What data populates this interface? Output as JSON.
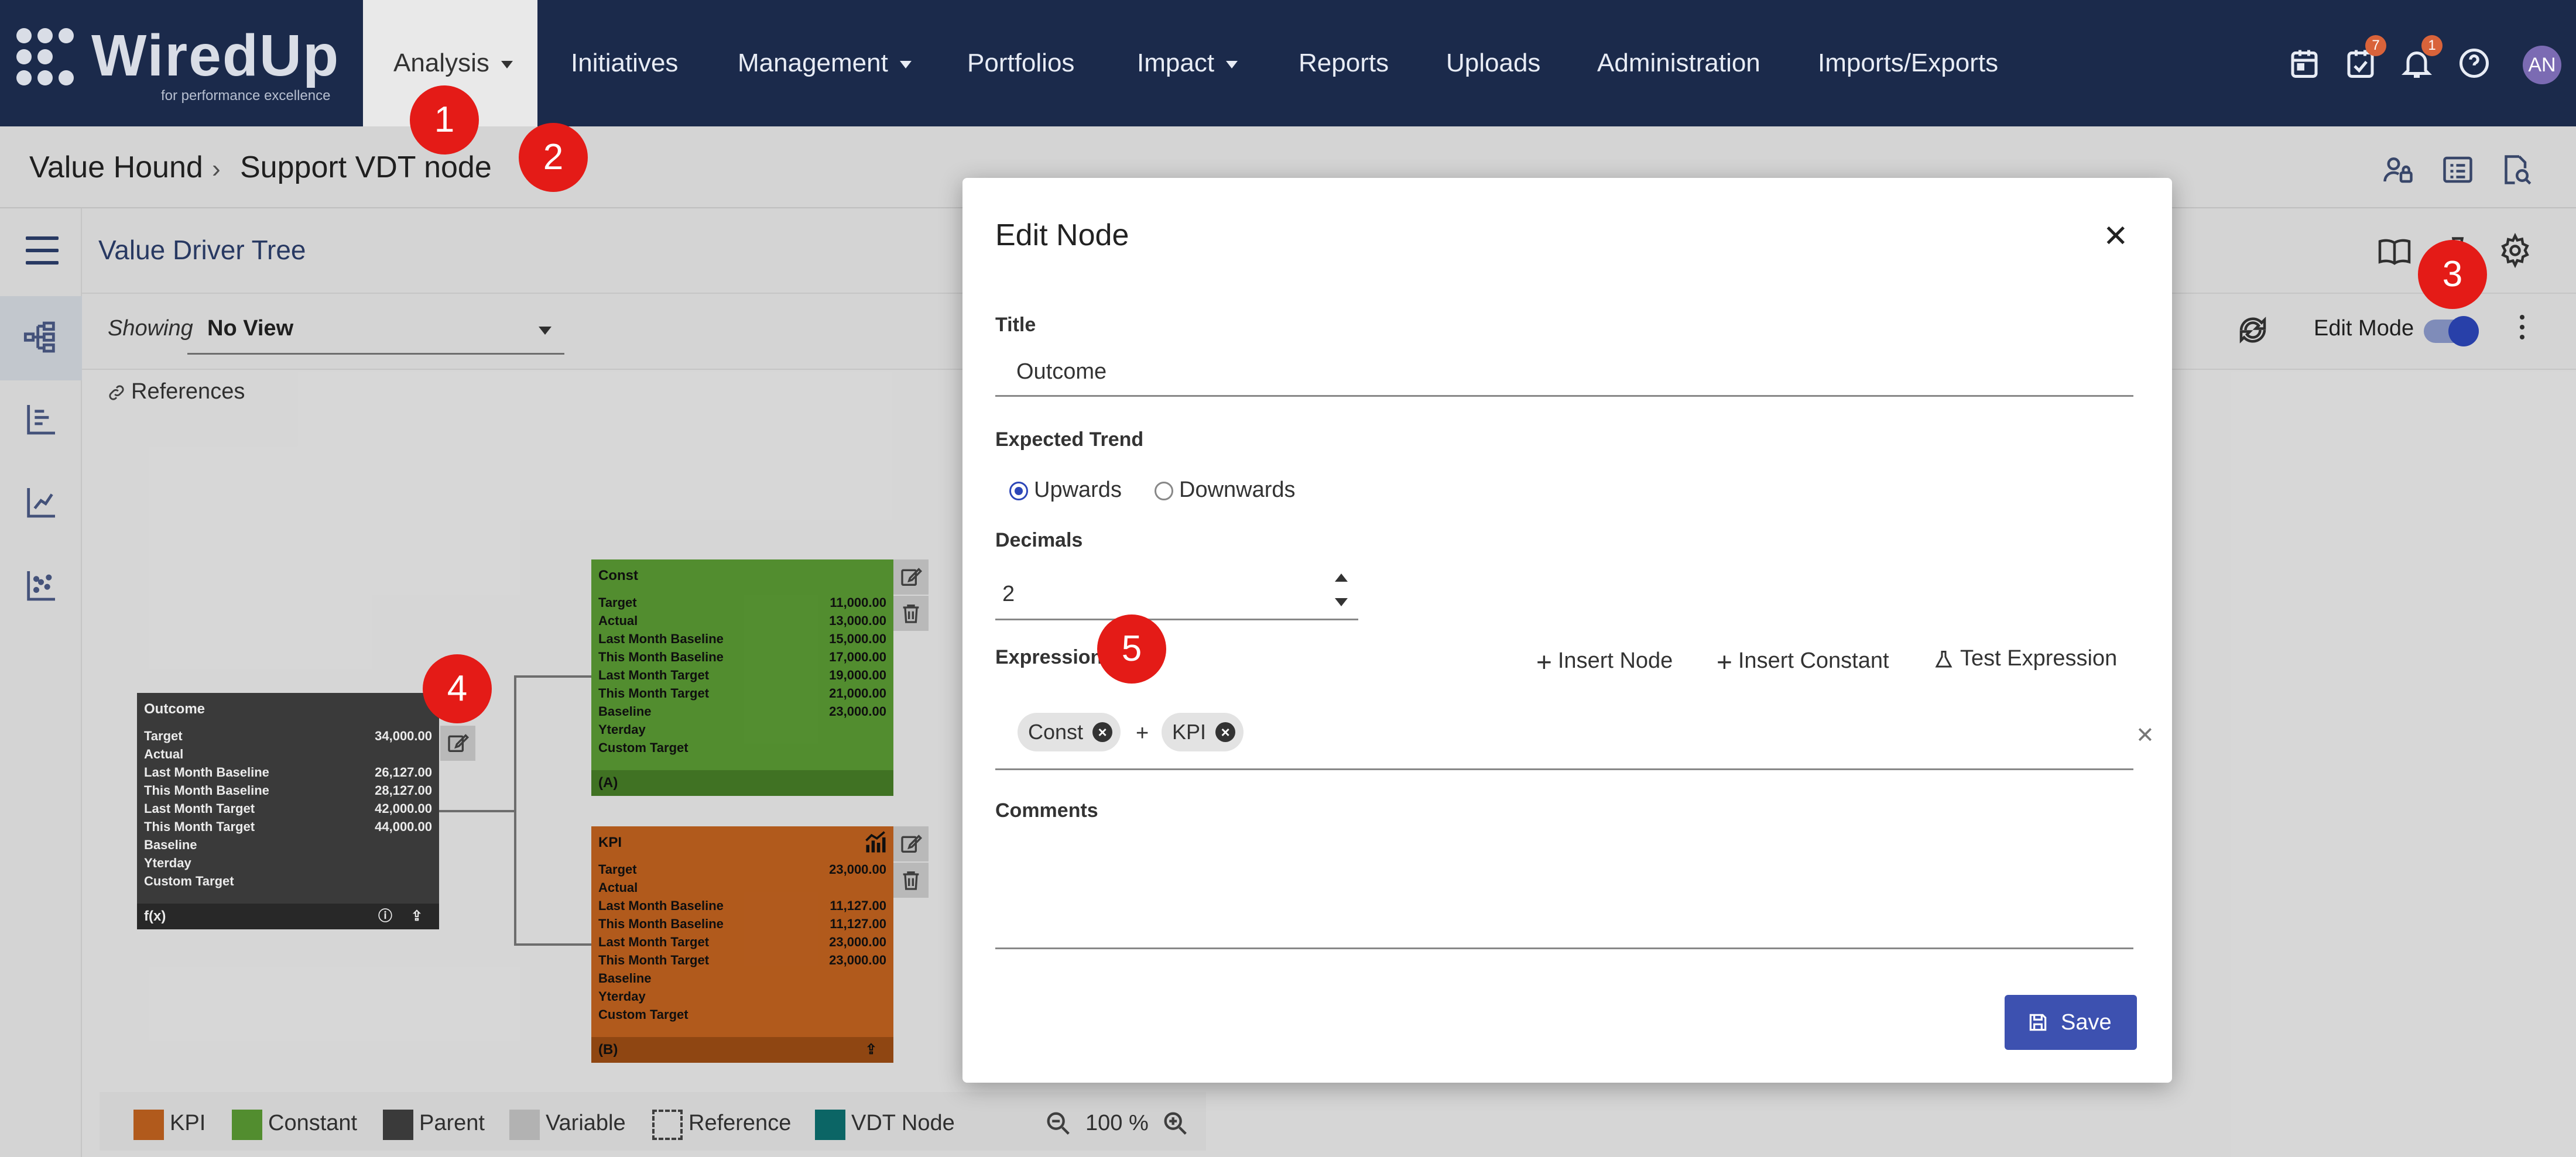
{
  "app": {
    "logo_text": "WiredUp",
    "logo_tagline": "for performance excellence",
    "nav": [
      {
        "label": "Analysis",
        "has_dropdown": true,
        "active": true
      },
      {
        "label": "Initiatives",
        "has_dropdown": false
      },
      {
        "label": "Management",
        "has_dropdown": true
      },
      {
        "label": "Portfolios",
        "has_dropdown": false
      },
      {
        "label": "Impact",
        "has_dropdown": true
      },
      {
        "label": "Reports",
        "has_dropdown": false
      },
      {
        "label": "Uploads",
        "has_dropdown": false
      },
      {
        "label": "Administration",
        "has_dropdown": false
      },
      {
        "label": "Imports/Exports",
        "has_dropdown": false
      }
    ],
    "top_icons": [
      {
        "icon": "calendar-icon"
      },
      {
        "icon": "tasks-icon",
        "badge": "7"
      },
      {
        "icon": "bell-icon",
        "badge": "1"
      },
      {
        "icon": "help-icon"
      }
    ],
    "avatar_initials": "AN",
    "colors": {
      "nav_bg": "#1b2a4b",
      "accent": "#2c46b8",
      "save_button": "#3d51b0",
      "callout": "#e41b17"
    }
  },
  "breadcrumb": {
    "items": [
      "Value Hound",
      "Support VDT node"
    ],
    "icons": [
      "user-lock-icon",
      "list-icon",
      "document-search-icon"
    ]
  },
  "page": {
    "title": "Value Driver Tree",
    "showing_label": "Showing",
    "showing_value": "No View",
    "references_label": "References",
    "edit_mode_label": "Edit Mode",
    "edit_mode_on": true,
    "header_icons": [
      "book-icon",
      "pin-icon",
      "gear-icon"
    ]
  },
  "tree": {
    "outcome": {
      "title": "Outcome",
      "color": "#3f3f3f",
      "rows": [
        {
          "label": "Target",
          "value": "34,000.00"
        },
        {
          "label": "Actual",
          "value": ""
        },
        {
          "label": "Last Month Baseline",
          "value": "26,127.00"
        },
        {
          "label": "This Month Baseline",
          "value": "28,127.00"
        },
        {
          "label": "Last Month Target",
          "value": "42,000.00"
        },
        {
          "label": "This Month Target",
          "value": "44,000.00"
        },
        {
          "label": "Baseline",
          "value": ""
        },
        {
          "label": "Yterday",
          "value": ""
        },
        {
          "label": "Custom Target",
          "value": ""
        }
      ],
      "footer": "f(x)"
    },
    "const": {
      "title": "Const",
      "color": "#5a9a34",
      "rows": [
        {
          "label": "Target",
          "value": "11,000.00"
        },
        {
          "label": "Actual",
          "value": "13,000.00"
        },
        {
          "label": "Last Month Baseline",
          "value": "15,000.00"
        },
        {
          "label": "This Month Baseline",
          "value": "17,000.00"
        },
        {
          "label": "Last Month Target",
          "value": "19,000.00"
        },
        {
          "label": "This Month Target",
          "value": "21,000.00"
        },
        {
          "label": "Baseline",
          "value": "23,000.00"
        },
        {
          "label": "Yterday",
          "value": ""
        },
        {
          "label": "Custom Target",
          "value": ""
        }
      ],
      "footer": "(A)"
    },
    "kpi": {
      "title": "KPI",
      "color": "#c0621f",
      "rows": [
        {
          "label": "Target",
          "value": "23,000.00"
        },
        {
          "label": "Actual",
          "value": ""
        },
        {
          "label": "Last Month Baseline",
          "value": "11,127.00"
        },
        {
          "label": "This Month Baseline",
          "value": "11,127.00"
        },
        {
          "label": "Last Month Target",
          "value": "23,000.00"
        },
        {
          "label": "This Month Target",
          "value": "23,000.00"
        },
        {
          "label": "Baseline",
          "value": ""
        },
        {
          "label": "Yterday",
          "value": ""
        },
        {
          "label": "Custom Target",
          "value": ""
        }
      ],
      "footer": "(B)"
    }
  },
  "legend": {
    "items": [
      {
        "label": "KPI",
        "color": "#c0621f"
      },
      {
        "label": "Constant",
        "color": "#5a9a34"
      },
      {
        "label": "Parent",
        "color": "#3f3f3f"
      },
      {
        "label": "Variable",
        "color": "#c2c2c2"
      },
      {
        "label": "Reference",
        "color": "dashed"
      },
      {
        "label": "VDT Node",
        "color": "#0d6e6e"
      }
    ],
    "zoom": "100 %"
  },
  "modal": {
    "title": "Edit Node",
    "title_label": "Title",
    "title_value": "Outcome",
    "trend_label": "Expected Trend",
    "trend_options": [
      "Upwards",
      "Downwards"
    ],
    "trend_selected": "Upwards",
    "decimals_label": "Decimals",
    "decimals_value": "2",
    "expression_label": "Expression",
    "insert_node": "Insert Node",
    "insert_constant": "Insert Constant",
    "test_expression": "Test Expression",
    "expression_tokens": [
      "Const",
      "+",
      "KPI"
    ],
    "comments_label": "Comments",
    "comments_value": "",
    "save_label": "Save"
  },
  "callouts": [
    "1",
    "2",
    "3",
    "4",
    "5"
  ]
}
